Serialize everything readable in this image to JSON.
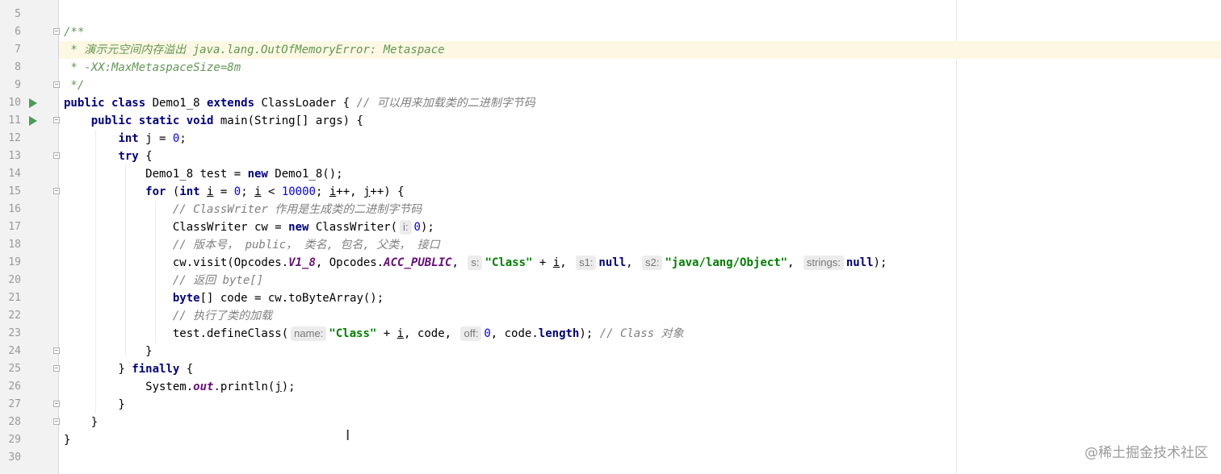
{
  "editor": {
    "lines": [
      {
        "n": "5",
        "html": ""
      },
      {
        "n": "6",
        "html": "<span class=\"doc\">/**</span>",
        "fold": "open"
      },
      {
        "n": "7",
        "html": "<span class=\"doc\"> * 演示元空间内存溢出 java.lang.OutOfMemoryError: Metaspace</span>"
      },
      {
        "n": "8",
        "html": "<span class=\"doc\"> * -XX:MaxMetaspaceSize=8m</span>"
      },
      {
        "n": "9",
        "html": "<span class=\"doc\"> */</span>",
        "fold": "close"
      },
      {
        "n": "10",
        "html": "<span class=\"kw\">public class</span> Demo1_8 <span class=\"kw\">extends</span> ClassLoader { <span class=\"cmt\">// 可以用来加载类的二进制字节码</span>",
        "run": true
      },
      {
        "n": "11",
        "html": "    <span class=\"kw\">public static void</span> main(String[] args) {",
        "run": true,
        "fold": "open"
      },
      {
        "n": "12",
        "html": "        <span class=\"kw\">int</span> j = <span class=\"num\">0</span>;"
      },
      {
        "n": "13",
        "html": "        <span class=\"kw\">try</span> {",
        "fold": "open"
      },
      {
        "n": "14",
        "html": "            Demo1_8 test = <span class=\"kw\">new</span> Demo1_8();"
      },
      {
        "n": "15",
        "html": "            <span class=\"kw\">for</span> (<span class=\"kw\">int</span> <span class=\"ul\">i</span> = <span class=\"num\">0</span>; <span class=\"ul\">i</span> &lt; <span class=\"num\">10000</span>; <span class=\"ul\">i</span>++, <span class=\"ul\">j</span>++) {",
        "fold": "open"
      },
      {
        "n": "16",
        "html": "                <span class=\"cmt\">// ClassWriter 作用是生成类的二进制字节码</span>"
      },
      {
        "n": "17",
        "html": "                ClassWriter cw = <span class=\"kw\">new</span> ClassWriter(<span class=\"hint\">i:</span><span class=\"num\">0</span>);"
      },
      {
        "n": "18",
        "html": "                <span class=\"cmt\">// 版本号， public， 类名, 包名, 父类， 接口</span>"
      },
      {
        "n": "19",
        "html": "                cw.visit(Opcodes.<span class=\"field\">V1_8</span>, Opcodes.<span class=\"field\">ACC_PUBLIC</span>, <span class=\"hint\">s:</span><span class=\"str\">\"Class\"</span> + <span class=\"ul\">i</span>, <span class=\"hint\">s1:</span><span class=\"kw\">null</span>, <span class=\"hint\">s2:</span><span class=\"str\">\"java/lang/Object\"</span>, <span class=\"hint\">strings:</span><span class=\"kw\">null</span>);"
      },
      {
        "n": "20",
        "html": "                <span class=\"cmt\">// 返回 byte[]</span>"
      },
      {
        "n": "21",
        "html": "                <span class=\"kw\">byte</span>[] code = cw.toByteArray();"
      },
      {
        "n": "22",
        "html": "                <span class=\"cmt\">// 执行了类的加载</span>"
      },
      {
        "n": "23",
        "html": "                test.defineClass(<span class=\"hint\">name:</span><span class=\"str\">\"Class\"</span> + <span class=\"ul\">i</span>, code, <span class=\"hint\">off:</span><span class=\"num\">0</span>, code.<span class=\"kw\">length</span>); <span class=\"cmt\">// Class 对象</span>"
      },
      {
        "n": "24",
        "html": "            }",
        "fold": "close"
      },
      {
        "n": "25",
        "html": "        } <span class=\"kw\">finally</span> {",
        "fold": "close"
      },
      {
        "n": "26",
        "html": "            System.<span class=\"field\">out</span>.println(<span class=\"ul\">j</span>);"
      },
      {
        "n": "27",
        "html": "        }",
        "fold": "close"
      },
      {
        "n": "28",
        "html": "    }",
        "fold": "close"
      },
      {
        "n": "29",
        "html": "}"
      },
      {
        "n": "30",
        "html": ""
      }
    ]
  },
  "watermark": "@稀土掘金技术社区"
}
